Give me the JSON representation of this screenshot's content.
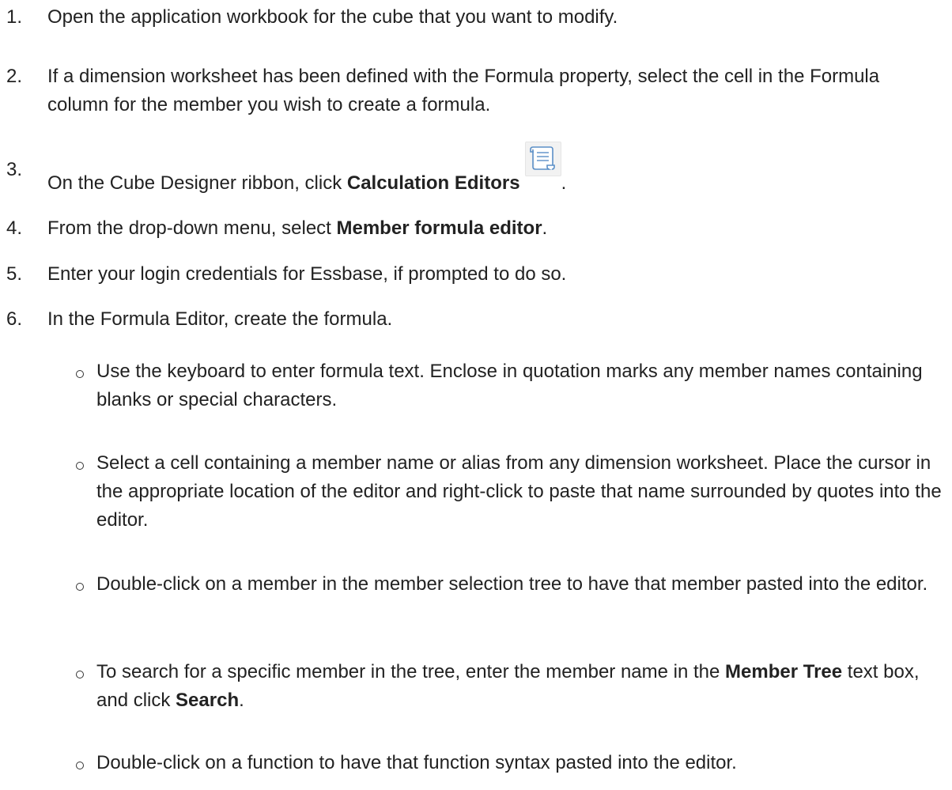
{
  "steps": [
    {
      "number": "1.",
      "parts": [
        "Open the application workbook for the cube that you want to modify."
      ]
    },
    {
      "number": "2.",
      "parts": [
        "If a dimension worksheet has been defined with the Formula property, select the cell in the Formula column for the member you wish to create a formula."
      ]
    },
    {
      "number": "3.",
      "before": "On the Cube Designer ribbon, click ",
      "bold": "Calculation Editors",
      "after": ".",
      "icon": "calculation-editors-icon"
    },
    {
      "number": "4.",
      "before": "From the drop-down menu, select ",
      "bold": "Member formula editor",
      "after": "."
    },
    {
      "number": "5.",
      "parts": [
        "Enter your login credentials for Essbase, if prompted to do so."
      ]
    },
    {
      "number": "6.",
      "parts": [
        "In the Formula Editor, create the formula."
      ]
    }
  ],
  "subitems": [
    {
      "text": "Use the keyboard to enter formula text. Enclose in quotation marks any member names containing blanks or special characters."
    },
    {
      "text": "Select a cell containing a member name or alias from any dimension worksheet. Place the cursor in the appropriate location of the editor and right-click to paste that name surrounded by quotes into the editor."
    },
    {
      "text": "Double-click on a member in the member selection tree to have that member pasted into the editor."
    },
    {
      "before": "To search for a specific member in the tree, enter the member name in the ",
      "bold1": "Member Tree",
      "middle": " text box, and click ",
      "bold2": "Search",
      "after": "."
    },
    {
      "text": "Double-click on a function to have that function syntax pasted into the editor."
    }
  ]
}
